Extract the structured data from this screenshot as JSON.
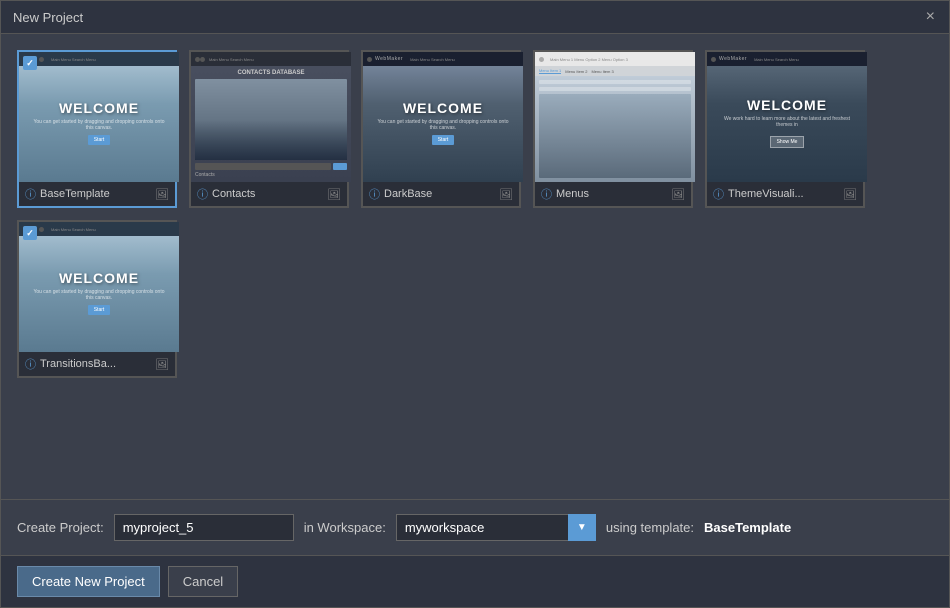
{
  "dialog": {
    "title": "New Project",
    "close_label": "×"
  },
  "templates": [
    {
      "id": "base-template",
      "name": "BaseTemplate",
      "selected": true,
      "type": "welcome"
    },
    {
      "id": "contacts",
      "name": "Contacts",
      "selected": false,
      "type": "contacts"
    },
    {
      "id": "darkbase",
      "name": "DarkBase",
      "selected": false,
      "type": "darkbase"
    },
    {
      "id": "menus",
      "name": "Menus",
      "selected": false,
      "type": "menus"
    },
    {
      "id": "themevisualizer",
      "name": "ThemeVisuali...",
      "selected": false,
      "type": "theme"
    },
    {
      "id": "transitionsbase",
      "name": "TransitionsBa...",
      "selected": false,
      "type": "welcome"
    }
  ],
  "footer": {
    "create_project_label": "Create Project:",
    "project_name": "myproject_5",
    "in_workspace_label": "in Workspace:",
    "workspace_value": "myworkspace",
    "using_template_label": "using template:",
    "selected_template": "BaseTemplate"
  },
  "actions": {
    "create_label": "Create New Project",
    "cancel_label": "Cancel"
  },
  "thumb_texts": {
    "welcome": "WELCOME",
    "welcome_sub": "You can get started by dragging and dropping controls onto this canvas.",
    "welcome_btn": "Start",
    "contacts_db": "CONTACTS DATABASE",
    "contacts_sub": "Contacts",
    "webmaker": "WebMaker",
    "darkbase_welcome": "WELCOME",
    "theme_welcome": "WELCOME",
    "theme_sub": "We work hard to learn more about the latest and freshest themes in",
    "theme_btn": "Show Me"
  }
}
